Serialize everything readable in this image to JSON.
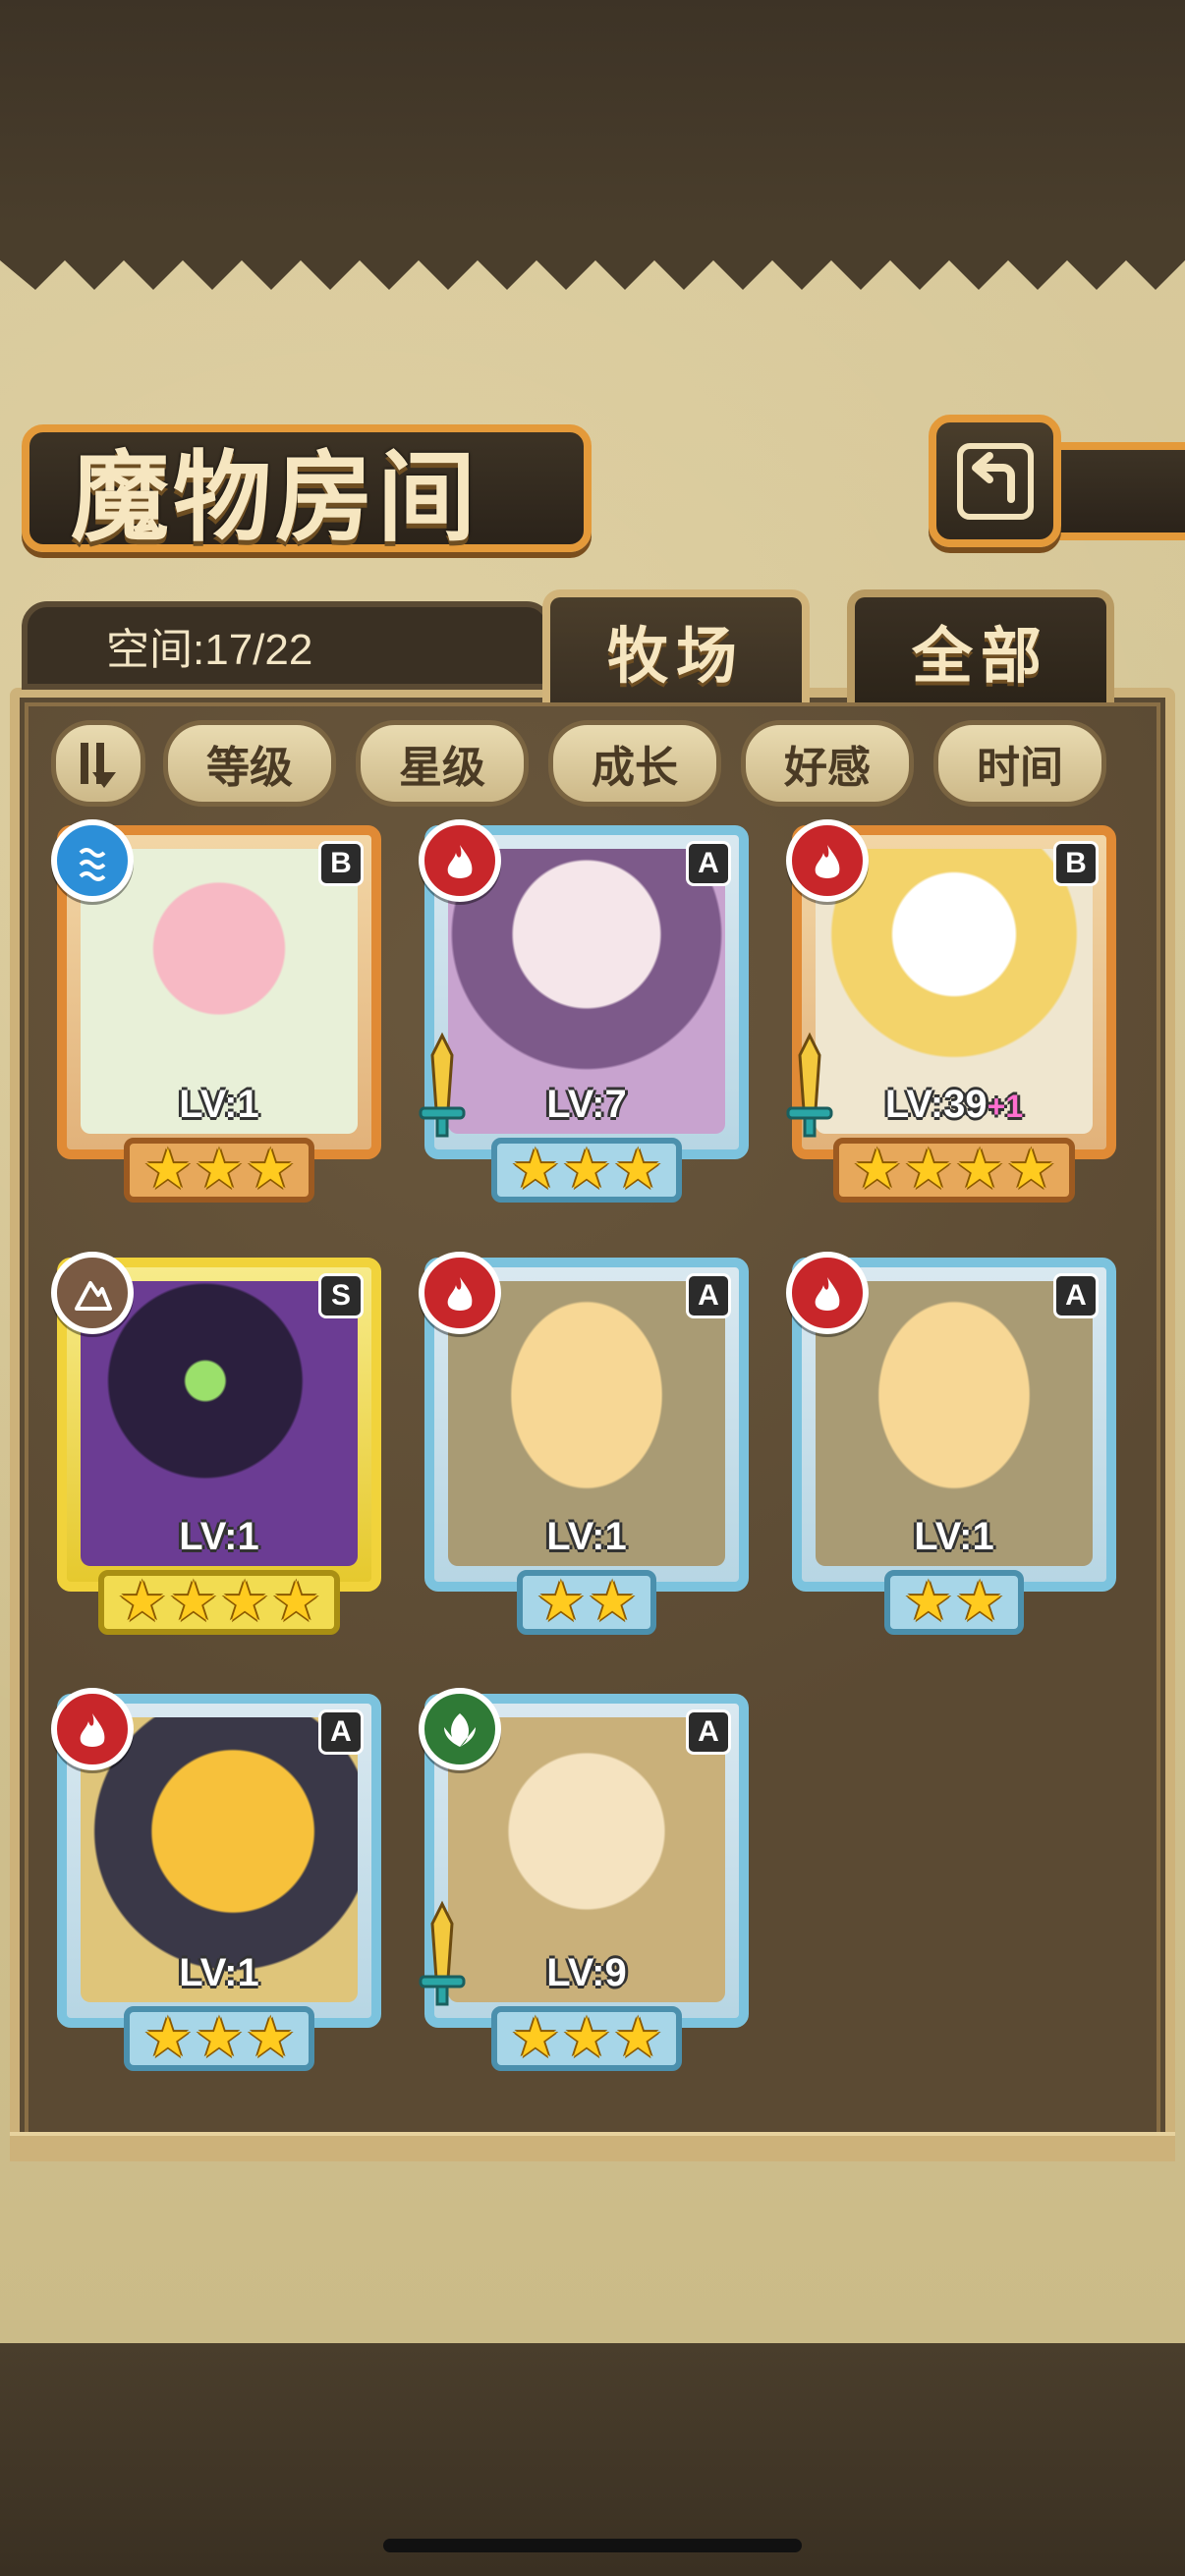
{
  "header": {
    "title": "魔物房间",
    "back_icon": "return-arrow-icon"
  },
  "status": {
    "space_label": "空间:17/22"
  },
  "tabs": [
    {
      "label": "牧场",
      "active": true
    },
    {
      "label": "全部",
      "active": false
    }
  ],
  "sort": {
    "toggle_icon": "sort-direction-icon",
    "buttons": [
      {
        "label": "等级"
      },
      {
        "label": "星级"
      },
      {
        "label": "成长"
      },
      {
        "label": "好感"
      },
      {
        "label": "时间"
      }
    ]
  },
  "monsters": [
    {
      "rank": "B",
      "element": "water",
      "level": "LV:1",
      "bonus": "",
      "stars": 3,
      "weapon": false
    },
    {
      "rank": "A",
      "element": "fire",
      "level": "LV:7",
      "bonus": "",
      "stars": 3,
      "weapon": true
    },
    {
      "rank": "B",
      "element": "fire",
      "level": "LV:39",
      "bonus": "+1",
      "stars": 4,
      "weapon": true
    },
    {
      "rank": "S",
      "element": "earth",
      "level": "LV:1",
      "bonus": "",
      "stars": 4,
      "weapon": false
    },
    {
      "rank": "A",
      "element": "fire",
      "level": "LV:1",
      "bonus": "",
      "stars": 2,
      "weapon": false
    },
    {
      "rank": "A",
      "element": "fire",
      "level": "LV:1",
      "bonus": "",
      "stars": 2,
      "weapon": false
    },
    {
      "rank": "A",
      "element": "fire",
      "level": "LV:1",
      "bonus": "",
      "stars": 3,
      "weapon": false
    },
    {
      "rank": "A",
      "element": "wind",
      "level": "LV:9",
      "bonus": "",
      "stars": 3,
      "weapon": true
    }
  ],
  "colors": {
    "frame_gold": "#e49a3a",
    "rank_b": "#e08a35",
    "rank_a": "#7cc3de",
    "rank_s": "#f1d33b",
    "fire": "#c8262a",
    "water": "#2c8fd8",
    "earth": "#7a5a43",
    "wind": "#2f7a36"
  }
}
